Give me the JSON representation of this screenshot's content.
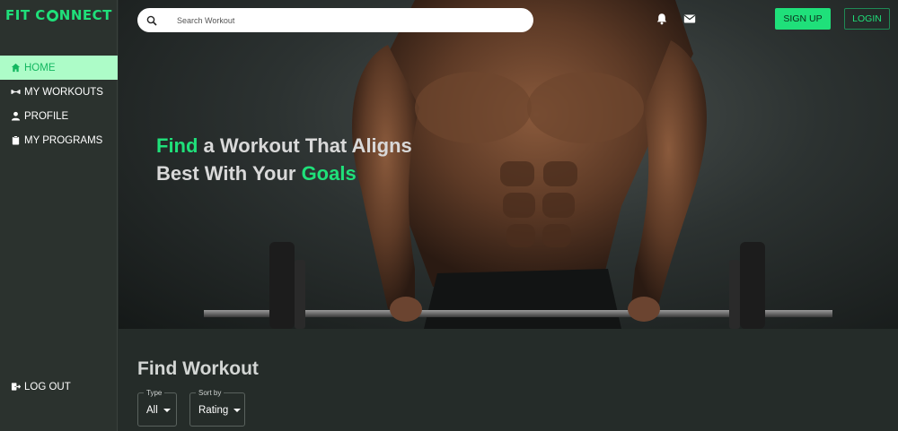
{
  "app": {
    "logo_left": "FIT C",
    "logo_right": "NNECT",
    "accent_color": "#1fe07a"
  },
  "sidebar": {
    "items": [
      {
        "label": "HOME",
        "icon": "home-icon",
        "active": true
      },
      {
        "label": "MY WORKOUTS",
        "icon": "dumbbell-icon",
        "active": false
      },
      {
        "label": "PROFILE",
        "icon": "person-icon",
        "active": false
      },
      {
        "label": "MY PROGRAMS",
        "icon": "clipboard-icon",
        "active": false
      }
    ],
    "logout_label": "LOG OUT",
    "logout_icon": "logout-icon"
  },
  "topbar": {
    "search_placeholder": "Search Workout",
    "search_icon": "search-icon",
    "notification_icon": "bell-icon",
    "mail_icon": "mail-icon",
    "signup_label": "SIGN UP",
    "login_label": "LOGIN"
  },
  "hero": {
    "line1_accent": "Find",
    "line1_rest": " a Workout That Aligns",
    "line2_start": "Best With Your ",
    "line2_accent": "Goals"
  },
  "find_workout": {
    "title": "Find Workout",
    "type_label": "Type",
    "type_value": "All",
    "sort_label": "Sort by",
    "sort_value": "Rating"
  }
}
